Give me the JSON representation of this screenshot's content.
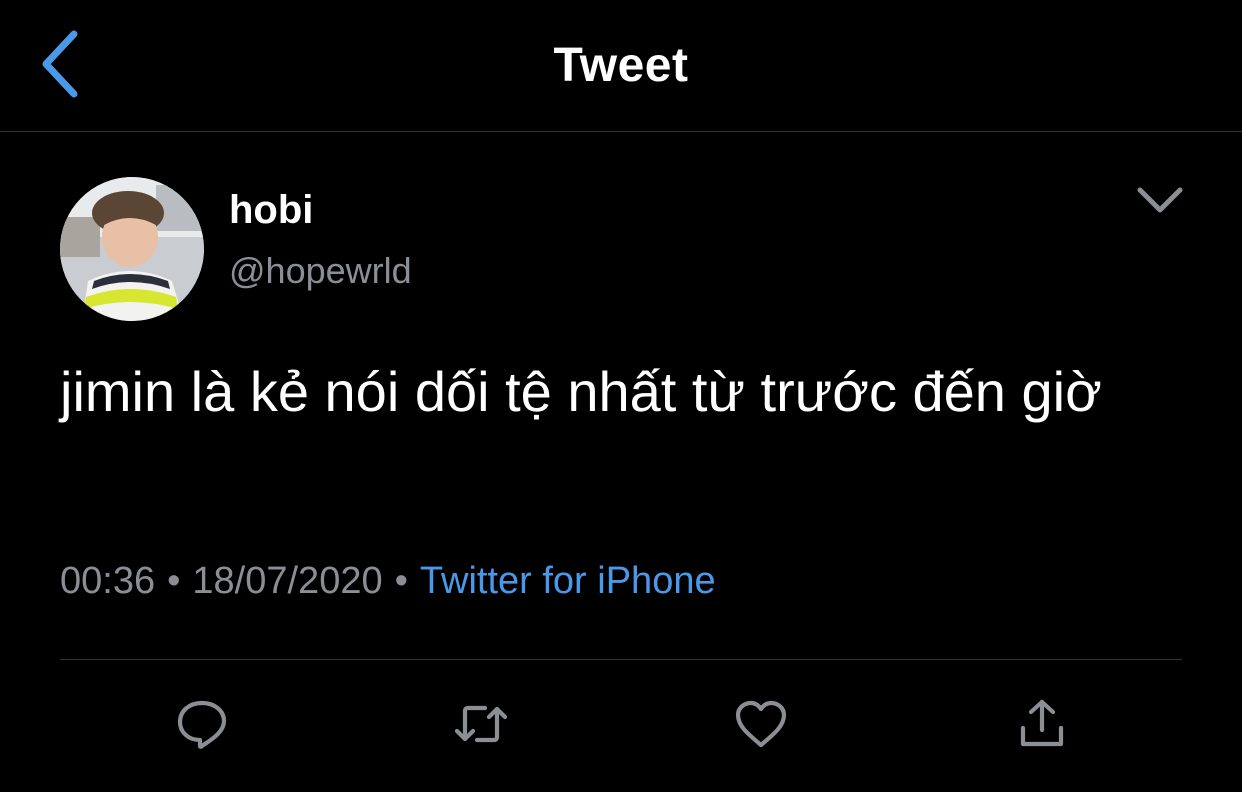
{
  "header": {
    "title": "Tweet",
    "back_icon": "chevron-left-icon",
    "accent_color": "#4a99e9"
  },
  "tweet": {
    "author": {
      "display_name": "hobi",
      "handle": "@hopewrld",
      "avatar_icon": "profile-photo"
    },
    "text": "jimin là kẻ nói dối tệ nhất từ trước đến giờ",
    "time": "00:36",
    "separator": "•",
    "date": "18/07/2020",
    "source": "Twitter for iPhone",
    "menu_icon": "chevron-down-icon"
  },
  "actions": [
    {
      "name": "reply",
      "icon": "reply-icon"
    },
    {
      "name": "retweet",
      "icon": "retweet-icon"
    },
    {
      "name": "like",
      "icon": "heart-icon"
    },
    {
      "name": "share",
      "icon": "share-icon"
    }
  ],
  "colors": {
    "background": "#000000",
    "text_primary": "#ffffff",
    "text_secondary": "#8b8f95",
    "link": "#4a99e9",
    "divider": "#2f3336"
  }
}
